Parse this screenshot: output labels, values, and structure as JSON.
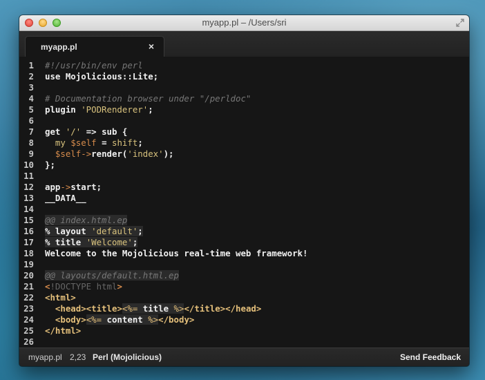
{
  "window": {
    "title": "myapp.pl – /Users/sri"
  },
  "tab": {
    "label": "myapp.pl",
    "close": "×"
  },
  "status": {
    "file": "myapp.pl",
    "position": "2,23",
    "syntax": "Perl (Mojolicious)",
    "feedback": "Send Feedback"
  },
  "lines": [
    {
      "n": "1",
      "segs": [
        {
          "t": "#!/usr/bin/env perl",
          "c": "c-comment"
        }
      ]
    },
    {
      "n": "2",
      "segs": [
        {
          "t": "use",
          "c": "c-kw"
        },
        {
          "t": " Mojolicious::Lite;",
          "c": ""
        }
      ]
    },
    {
      "n": "3",
      "segs": []
    },
    {
      "n": "4",
      "segs": [
        {
          "t": "# Documentation browser under \"/perldoc\"",
          "c": "c-comment"
        }
      ]
    },
    {
      "n": "5",
      "segs": [
        {
          "t": "plugin ",
          "c": ""
        },
        {
          "t": "'PODRenderer'",
          "c": "c-str"
        },
        {
          "t": ";",
          "c": ""
        }
      ]
    },
    {
      "n": "6",
      "segs": []
    },
    {
      "n": "7",
      "segs": [
        {
          "t": "get ",
          "c": ""
        },
        {
          "t": "'/'",
          "c": "c-str"
        },
        {
          "t": " => sub {",
          "c": ""
        }
      ]
    },
    {
      "n": "8",
      "segs": [
        {
          "t": "  ",
          "c": ""
        },
        {
          "t": "my",
          "c": "c-my"
        },
        {
          "t": " ",
          "c": ""
        },
        {
          "t": "$self",
          "c": "c-var"
        },
        {
          "t": " = ",
          "c": ""
        },
        {
          "t": "shift",
          "c": "c-str"
        },
        {
          "t": ";",
          "c": ""
        }
      ]
    },
    {
      "n": "9",
      "segs": [
        {
          "t": "  ",
          "c": ""
        },
        {
          "t": "$self",
          "c": "c-var"
        },
        {
          "t": "->",
          "c": "c-op"
        },
        {
          "t": "render(",
          "c": ""
        },
        {
          "t": "'index'",
          "c": "c-str"
        },
        {
          "t": ");",
          "c": ""
        }
      ]
    },
    {
      "n": "10",
      "segs": [
        {
          "t": "};",
          "c": ""
        }
      ]
    },
    {
      "n": "11",
      "segs": []
    },
    {
      "n": "12",
      "segs": [
        {
          "t": "app",
          "c": ""
        },
        {
          "t": "->",
          "c": "c-op"
        },
        {
          "t": "start;",
          "c": ""
        }
      ]
    },
    {
      "n": "13",
      "segs": [
        {
          "t": "__DATA__",
          "c": ""
        }
      ]
    },
    {
      "n": "14",
      "segs": []
    },
    {
      "n": "15",
      "segs": [
        {
          "t": "@@ index.html.ep",
          "c": "c-comment hl"
        }
      ]
    },
    {
      "n": "16",
      "segs": [
        {
          "t": "% layout ",
          "c": "hl"
        },
        {
          "t": "'default'",
          "c": "c-str hl"
        },
        {
          "t": ";",
          "c": "hl"
        }
      ]
    },
    {
      "n": "17",
      "segs": [
        {
          "t": "% title ",
          "c": "hl"
        },
        {
          "t": "'Welcome'",
          "c": "c-str hl"
        },
        {
          "t": ";",
          "c": "hl"
        }
      ]
    },
    {
      "n": "18",
      "segs": [
        {
          "t": "Welcome to the Mojolicious real-time web framework!",
          "c": ""
        }
      ]
    },
    {
      "n": "19",
      "segs": []
    },
    {
      "n": "20",
      "segs": [
        {
          "t": "@@ layouts/default.html.ep",
          "c": "c-comment hl"
        }
      ]
    },
    {
      "n": "21",
      "segs": [
        {
          "t": "<",
          "c": "c-lt"
        },
        {
          "t": "!DOCTYPE html",
          "c": "c-doct"
        },
        {
          "t": ">",
          "c": "c-lt"
        }
      ]
    },
    {
      "n": "22",
      "segs": [
        {
          "t": "<html>",
          "c": "c-tag"
        }
      ]
    },
    {
      "n": "23",
      "segs": [
        {
          "t": "  ",
          "c": ""
        },
        {
          "t": "<head><title>",
          "c": "c-tag"
        },
        {
          "t": "<%=",
          "c": "c-ep hl"
        },
        {
          "t": " title ",
          "c": "hl"
        },
        {
          "t": "%>",
          "c": "c-ep hl"
        },
        {
          "t": "</title></head>",
          "c": "c-tag"
        }
      ]
    },
    {
      "n": "24",
      "segs": [
        {
          "t": "  ",
          "c": ""
        },
        {
          "t": "<body>",
          "c": "c-tag"
        },
        {
          "t": "<%=",
          "c": "c-ep hl"
        },
        {
          "t": " content ",
          "c": "hl"
        },
        {
          "t": "%>",
          "c": "c-ep hl"
        },
        {
          "t": "</body>",
          "c": "c-tag"
        }
      ]
    },
    {
      "n": "25",
      "segs": [
        {
          "t": "</html>",
          "c": "c-tag"
        }
      ]
    },
    {
      "n": "26",
      "segs": []
    }
  ]
}
